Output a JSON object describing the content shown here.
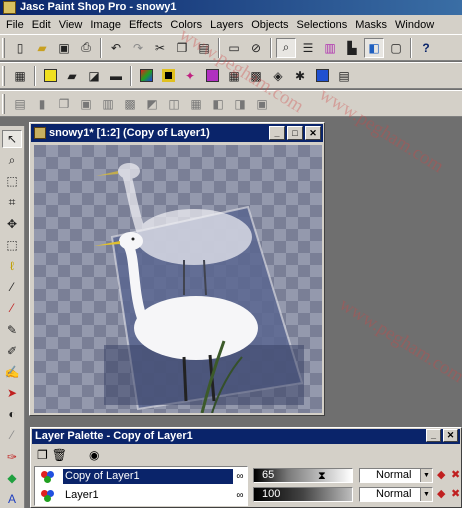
{
  "window": {
    "title": "Jasc Paint Shop Pro - snowy1"
  },
  "menu": [
    "File",
    "Edit",
    "View",
    "Image",
    "Effects",
    "Colors",
    "Layers",
    "Objects",
    "Selections",
    "Masks",
    "Window"
  ],
  "document": {
    "title": "snowy1* [1:2] (Copy of Layer1)"
  },
  "layer_palette": {
    "title": "Layer Palette - Copy of Layer1",
    "layers": [
      {
        "name": "Copy of Layer1",
        "opacity": "65",
        "blend_mode": "Normal",
        "selected": true
      },
      {
        "name": "Layer1",
        "opacity": "100",
        "blend_mode": "Normal",
        "selected": false
      }
    ]
  },
  "watermark": "www.pegham.com",
  "colors": {
    "titlebar": "#0a246a",
    "face": "#d4d0c8",
    "workspace": "#6f6f6f"
  }
}
